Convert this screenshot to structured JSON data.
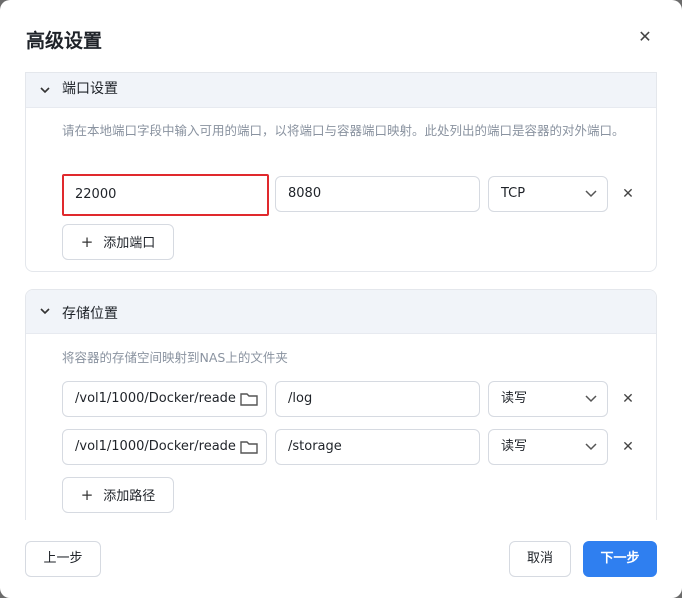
{
  "dialog": {
    "title": "高级设置"
  },
  "ports": {
    "title": "端口设置",
    "description": "请在本地端口字段中输入可用的端口，以将端口与容器端口映射。此处列出的端口是容器的对外端口。",
    "rows": [
      {
        "host_port": "22000",
        "container_port": "8080",
        "protocol": "TCP"
      }
    ],
    "add_label": "添加端口"
  },
  "storage": {
    "title": "存储位置",
    "description": "将容器的存储空间映射到NAS上的文件夹",
    "rows": [
      {
        "host_path": "/vol1/1000/Docker/reade",
        "container_path": "/log",
        "mode": "读写"
      },
      {
        "host_path": "/vol1/1000/Docker/reade",
        "container_path": "/storage",
        "mode": "读写"
      }
    ],
    "add_label": "添加路径"
  },
  "footer": {
    "prev_label": "上一步",
    "cancel_label": "取消",
    "next_label": "下一步"
  },
  "icons": {
    "close": "close-icon",
    "collapse": "chevron-down-icon",
    "folder": "folder-icon",
    "select": "chevron-down-icon",
    "remove": "close-icon",
    "add": "plus-icon"
  },
  "colors": {
    "primary": "#2f7ff0",
    "focus_border": "#e0292d",
    "section_header": "#f1f4f9"
  }
}
